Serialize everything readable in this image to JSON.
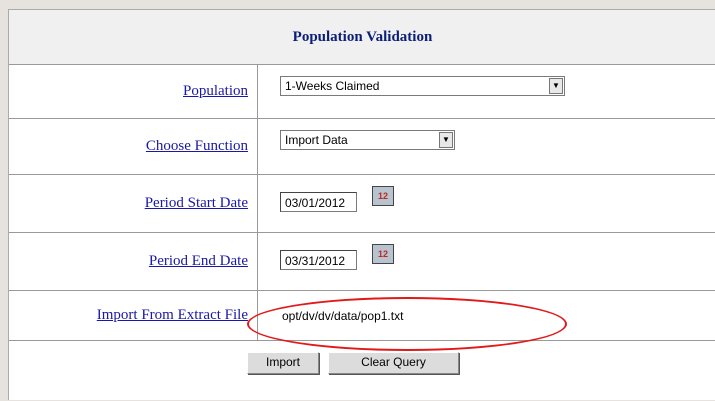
{
  "title": "Population Validation",
  "fields": [
    {
      "label": "Population",
      "value": "1-Weeks Claimed"
    },
    {
      "label": "Choose Function",
      "value": "Import Data"
    },
    {
      "label": "Period Start Date",
      "value": "03/01/2012"
    },
    {
      "label": "Period End Date",
      "value": "03/31/2012"
    },
    {
      "label": "Import From Extract File",
      "value": "opt/dv/dv/data/pop1.txt"
    }
  ],
  "calendar_icon_text": "12",
  "buttons": {
    "import": "Import",
    "clear": "Clear Query"
  },
  "colors": {
    "link": "#1a18a8",
    "title": "#0b1e78",
    "highlight": "#e31919"
  }
}
